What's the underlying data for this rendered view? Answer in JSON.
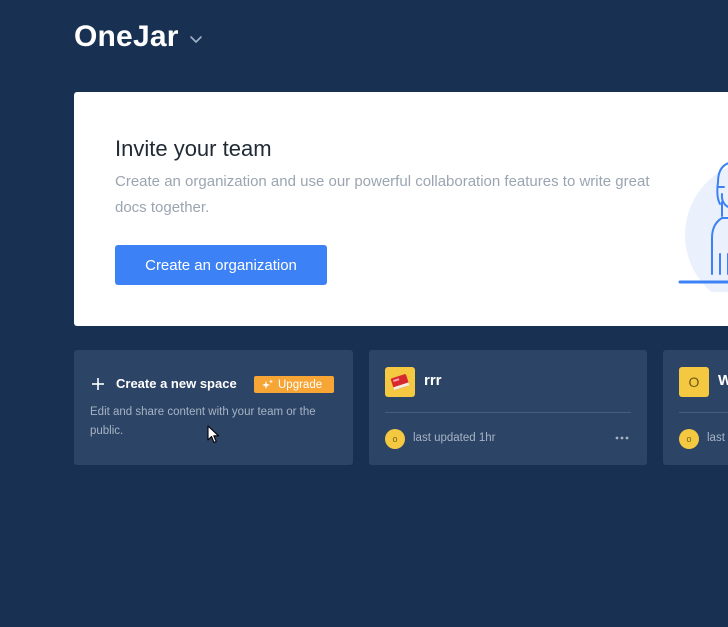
{
  "header": {
    "workspace_name": "OneJar",
    "chevron_icon": "chevron-down-icon"
  },
  "invite": {
    "title": "Invite your team",
    "description": "Create an organization and use our powerful collaboration features to write great docs together.",
    "button_label": "Create an organization",
    "accent_color": "#3c82f6"
  },
  "new_space": {
    "icon": "plus-icon",
    "label": "Create a new space",
    "badge_icon": "sparkle-icon",
    "badge_label": "Upgrade",
    "badge_color": "#f7a535",
    "description": "Edit and share content with your team or the public."
  },
  "spaces": [
    {
      "emoji_icon": "book-icon",
      "name": "rrr",
      "avatar_letter": "o",
      "updated": "last updated 1hr",
      "more_icon": "more-horizontal-icon"
    },
    {
      "emoji_letter": "O",
      "name": "W",
      "avatar_letter": "o",
      "updated": "last"
    }
  ]
}
